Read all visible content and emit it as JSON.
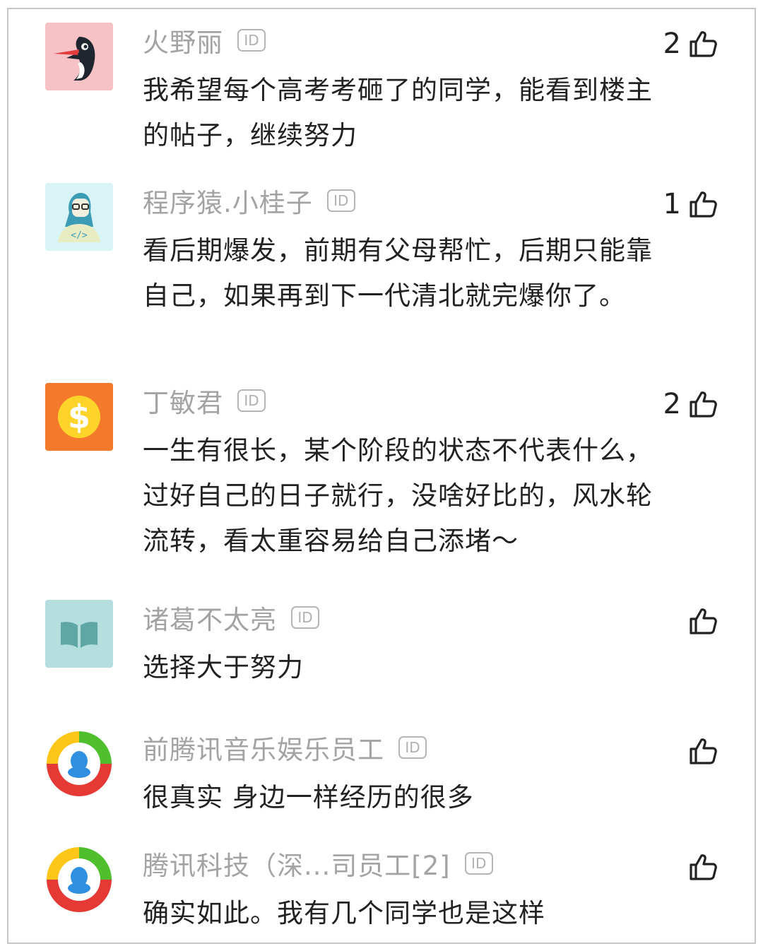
{
  "comments": [
    {
      "avatar": "woodpecker-avatar",
      "name": "火野丽",
      "id_badge": "ID",
      "text": "我希望每个高考考砸了的同学，能看到楼主的帖子，继续努力",
      "likes": "2"
    },
    {
      "avatar": "programmer-avatar",
      "name": "程序猿.小桂子",
      "id_badge": "ID",
      "text": "看后期爆发，前期有父母帮忙，后期只能靠自己，如果再到下一代清北就完爆你了。",
      "likes": "1"
    },
    {
      "avatar": "dollar-avatar",
      "name": "丁敏君",
      "id_badge": "ID",
      "text": "一生有很长，某个阶段的状态不代表什么，过好自己的日子就行，没啥好比的，风水轮流转，看太重容易给自己添堵～",
      "likes": "2"
    },
    {
      "avatar": "book-avatar",
      "name": "诸葛不太亮",
      "id_badge": "ID",
      "text": "选择大于努力",
      "likes": ""
    },
    {
      "avatar": "tencent-avatar",
      "name": "前腾讯音乐娱乐员工",
      "id_badge": "ID",
      "text": "很真实 身边一样经历的很多",
      "likes": ""
    },
    {
      "avatar": "tencent-avatar",
      "name": "腾讯科技（深...司员工[2]",
      "id_badge": "ID",
      "text": "确实如此。我有几个同学也是这样",
      "likes": ""
    }
  ]
}
